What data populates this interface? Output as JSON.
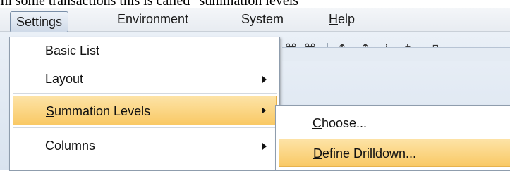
{
  "caption": "In some transactions this is called \"summation levels\"",
  "menubar": {
    "items": [
      {
        "label": "Settings"
      },
      {
        "label": "Environment"
      },
      {
        "label": "System"
      },
      {
        "label": "Help"
      }
    ]
  },
  "toolbar": {
    "icons": [
      "find-icon",
      "find-next-icon",
      "first-page-icon",
      "previous-page-icon",
      "next-page-icon",
      "last-page-icon"
    ]
  },
  "settings_menu": {
    "items": [
      {
        "label": "Basic List",
        "has_submenu": false
      },
      {
        "label": "Layout",
        "has_submenu": true
      },
      {
        "label": "Summation Levels",
        "has_submenu": true,
        "highlighted": true
      },
      {
        "label": "Columns",
        "has_submenu": true
      }
    ]
  },
  "summation_submenu": {
    "items": [
      {
        "label": "Choose..."
      },
      {
        "label": "Define Drilldown...",
        "highlighted": true
      }
    ]
  },
  "colors": {
    "highlight": "#f9c965",
    "menu_border": "#8f9dad",
    "toolbar_bg": "#dde6f1"
  }
}
